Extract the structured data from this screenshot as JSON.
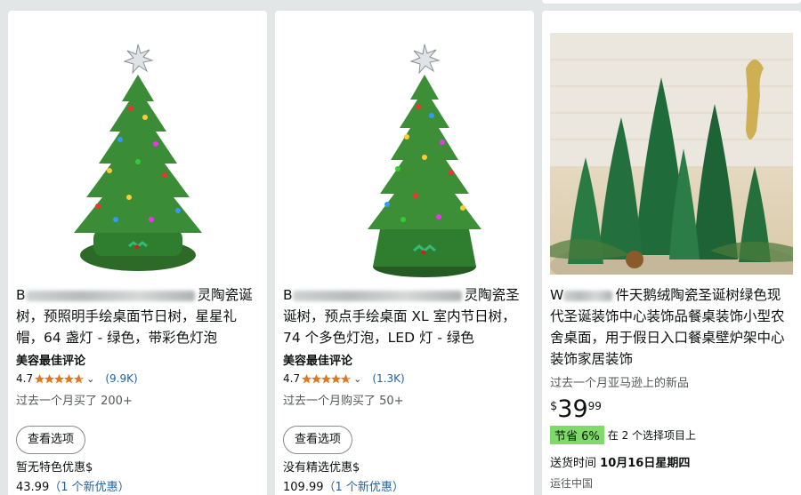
{
  "products": [
    {
      "title_blurred_prefix": "B",
      "title_visible_suffix": "灵陶瓷",
      "title_rest": "诞树，预照明手绘桌面节日树，星星礼帽，64 盏灯 - 绿色，带彩色灯泡",
      "badge": "美容最佳评论",
      "rating": "4.7",
      "stars_value": 4.7,
      "review_count": "(9.9K)",
      "bought": "过去一个月买了 200+",
      "button_label": "查看选项",
      "deal_text": "暂无特色优惠$",
      "price_text": "43.99",
      "offers_text": "（1 个新优惠）"
    },
    {
      "title_blurred_prefix": "B",
      "title_visible_suffix": "灵陶瓷",
      "title_rest": "圣诞树，预点手绘桌面 XL 室内节日树，74 个多色灯泡，LED 灯 - 绿色",
      "badge": "美容最佳评论",
      "rating": "4.7",
      "stars_value": 4.7,
      "review_count": "(1.3K)",
      "bought": "过去一个月购买了 50+",
      "button_label": "查看选项",
      "deal_text": "没有精选优惠$",
      "price_text": "109.99",
      "offers_text": "（1 个新优惠）"
    },
    {
      "title_blurred_prefix": "W",
      "title_visible_suffix": "件天鹅绒陶瓷圣诞树绿色现代圣诞装饰中心装饰品餐桌装饰小型农舍桌面，用于假日入口餐桌壁炉架中心装饰家居装饰",
      "subline": "过去一个月亚马逊上的新品",
      "price_symbol": "$",
      "price_whole": "39",
      "price_fraction": "99",
      "save_badge": "节省 6%",
      "save_note": "在 2 个选择项目上",
      "delivery_label": "送货时间",
      "delivery_date": "10月16日星期四",
      "ship_from": "运往中国"
    }
  ],
  "colors": {
    "link": "#2162a1",
    "star": "#de7921",
    "save_badge": "#7fda69",
    "tree_green": "#2f7d2e",
    "button_border": "#888c8c"
  },
  "icons": [
    "star-icon",
    "chevron-down-icon"
  ]
}
